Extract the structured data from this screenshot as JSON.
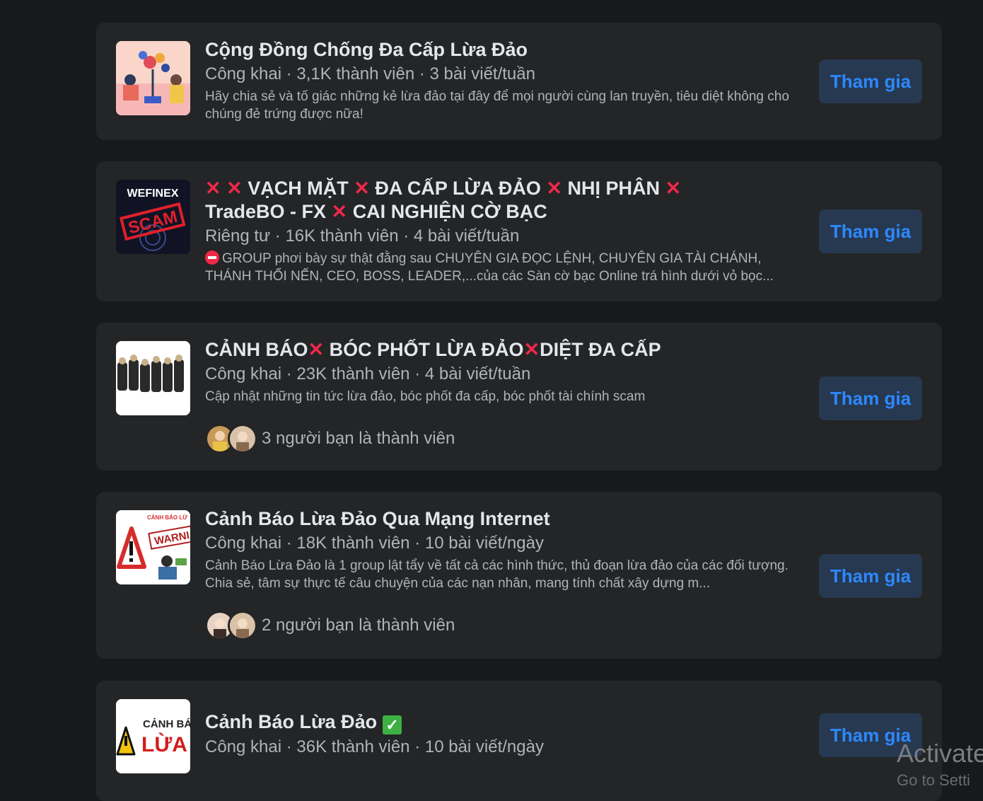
{
  "groups": [
    {
      "title": "Cộng Đồng Chống Đa Cấp Lừa Đảo",
      "meta": "Công khai · 3,1K thành viên · 3 bài viết/tuần",
      "description": "Hãy chia sẻ và tố giác những kẻ lừa đảo tại đây để mọi người cùng lan truyền, tiêu diệt không cho chúng đẻ trứng được nữa!",
      "join_label": "Tham gia"
    },
    {
      "thumb_logo": "WEFINEX",
      "thumb_stamp": "SCAM",
      "title_parts": [
        "✕ ✕",
        "VẠCH MẶT",
        "✕",
        "ĐA CẤP LỪA ĐẢO",
        "✕",
        "NHỊ PHÂN",
        "✕",
        "TradeBO - FX",
        "✕",
        "CAI NGHIỆN CỜ BẠC"
      ],
      "meta": "Riêng tư · 16K thành viên · 4 bài viết/tuần",
      "description": "GROUP phơi bày sự thật đằng sau CHUYÊN GIA ĐỌC LỆNH, CHUYÊN GIA TÀI CHÁNH, THÁNH THỔI NẾN, CEO, BOSS, LEADER,...của các Sàn cờ bạc Online trá hình dưới vỏ bọc...",
      "join_label": "Tham gia"
    },
    {
      "title_parts": [
        "CẢNH BÁO",
        "✕",
        "BÓC PHỐT LỪA ĐẢO",
        "✕",
        "DIỆT ĐA CẤP"
      ],
      "meta": "Công khai · 23K thành viên · 4 bài viết/tuần",
      "description": "Cập nhật những tin tức lừa đảo, bóc phốt đa cấp, bóc phốt tài chính scam",
      "friends": "3 người bạn là thành viên",
      "join_label": "Tham gia"
    },
    {
      "thumb_text_top": "CẢNH BÁO LỪ",
      "thumb_text_warn": "WARNI",
      "title": "Cảnh Báo Lừa Đảo Qua Mạng Internet",
      "meta": "Công khai · 18K thành viên · 10 bài viết/ngày",
      "description": "Cảnh Báo Lừa Đảo là 1 group lật tẩy về tất cả các hình thức, thủ đoạn lừa đảo của các đối tượng. Chia sẻ, tâm sự thực tế câu chuyện của các nạn nhân, mang tính chất xây dựng m...",
      "friends": "2 người bạn là thành viên",
      "join_label": "Tham gia"
    },
    {
      "thumb_text_top": "CẢNH BÁO",
      "thumb_text_big": "LỪA ĐẢ",
      "title": "Cảnh Báo Lừa Đảo",
      "check": "✓",
      "meta": "Công khai · 36K thành viên · 10 bài viết/ngày",
      "join_label": "Tham gia"
    }
  ],
  "watermark": {
    "line1": "Activate",
    "line2": "Go to Setti"
  },
  "colors": {
    "background": "#18191b",
    "card": "#242526",
    "button_bg": "#263951",
    "button_text": "#2d88ff",
    "cross": "#f02849"
  }
}
